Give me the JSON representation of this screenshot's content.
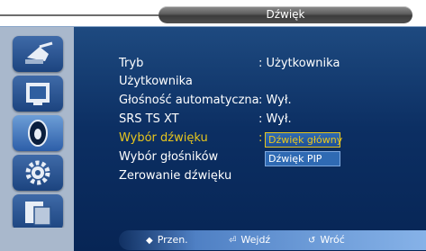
{
  "header": {
    "title": "Dźwięk"
  },
  "sidebar": {
    "items": [
      {
        "icon": "satellite-dish-icon"
      },
      {
        "icon": "picture-icon"
      },
      {
        "icon": "sound-icon",
        "selected": true
      },
      {
        "icon": "gear-icon"
      },
      {
        "icon": "input-source-icon"
      }
    ]
  },
  "menu": {
    "items": [
      {
        "label": "Tryb",
        "value": ": Użytkownika"
      },
      {
        "label": "Użytkownika",
        "value": ""
      },
      {
        "label": "Głośność automatyczna",
        "value": ": Wył."
      },
      {
        "label": "SRS TS XT",
        "value": ": Wył."
      },
      {
        "label": "Wybór dźwięku",
        "value": ":",
        "selected": true
      },
      {
        "label": "Wybór głośników",
        "value": ""
      },
      {
        "label": "Zerowanie dźwięku",
        "value": ""
      }
    ]
  },
  "dropdown": {
    "options": [
      "Dźwięk główny",
      "Dźwięk PIP"
    ],
    "highlighted": "Dźwięk główny"
  },
  "footer": {
    "move_glyph": "◆",
    "move": "Przen.",
    "enter_glyph": "⏎",
    "enter": "Wejdź",
    "return_glyph": "↺",
    "return": "Wróć"
  },
  "colors": {
    "panel": "#0c2f63",
    "sidebar": "#a9b8cc",
    "selected_text": "#e8c61d",
    "title_bar": "#505050"
  }
}
